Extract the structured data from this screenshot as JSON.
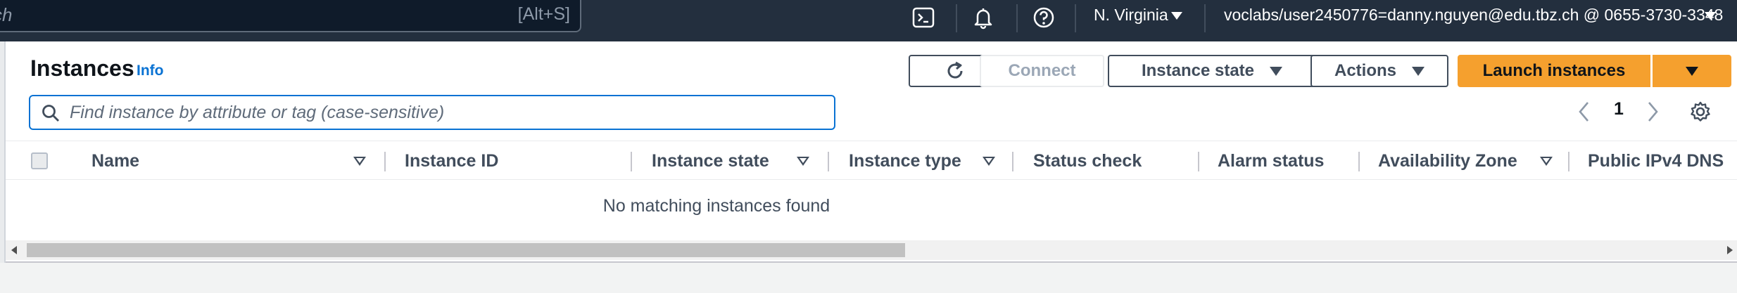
{
  "topnav": {
    "search_partial": "ch",
    "search_shortcut": "[Alt+S]",
    "region": "N. Virginia",
    "account": "voclabs/user2450776=danny.nguyen@edu.tbz.ch @ 0655-3730-3348",
    "icons": [
      "cloudshell-icon",
      "bell-icon",
      "help-icon"
    ]
  },
  "header": {
    "title": "Instances",
    "info": "Info"
  },
  "toolbar": {
    "refresh": "refresh-icon",
    "connect": "Connect",
    "instance_state": "Instance state",
    "actions": "Actions",
    "launch": "Launch instances"
  },
  "filter": {
    "placeholder": "Find instance by attribute or tag (case-sensitive)"
  },
  "pagination": {
    "page": "1"
  },
  "table": {
    "columns": [
      "Name",
      "Instance ID",
      "Instance state",
      "Instance type",
      "Status check",
      "Alarm status",
      "Availability Zone",
      "Public IPv4 DNS"
    ],
    "empty_message": "No matching instances found"
  },
  "colors": {
    "nav_bg": "#232f3e",
    "primary": "#f5a02e",
    "link": "#0972d3"
  }
}
